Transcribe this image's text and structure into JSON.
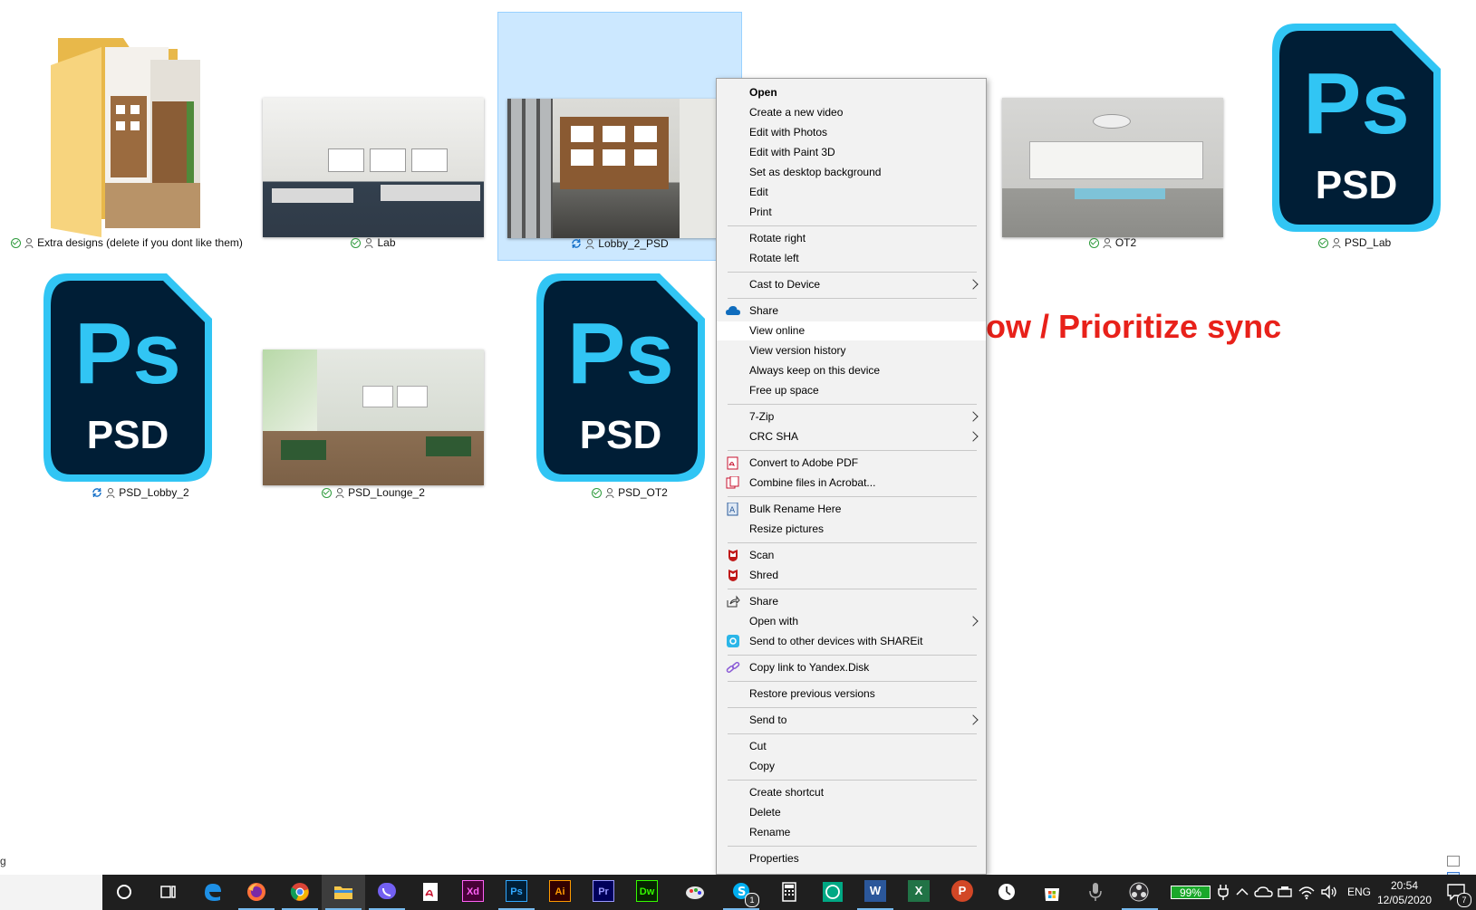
{
  "files": [
    {
      "name": "Extra designs (delete if you dont like them)",
      "status": "ok"
    },
    {
      "name": "Lab",
      "status": "ok"
    },
    {
      "name": "Lobby_2_PSD",
      "status": "sync"
    },
    {
      "name": "OT2",
      "status": "ok"
    },
    {
      "name": "PSD_Lab",
      "status": "ok"
    },
    {
      "name": "PSD_Lobby_2",
      "status": "sync"
    },
    {
      "name": "PSD_Lounge_2",
      "status": "ok"
    },
    {
      "name": "PSD_OT2",
      "status": "ok"
    }
  ],
  "ps_icon": {
    "main": "Ps",
    "sub": "PSD",
    "color": "#31c5f4",
    "bg": "#001e36"
  },
  "context_menu": {
    "items": [
      "Open",
      "Create a new video",
      "Edit with Photos",
      "Edit with Paint 3D",
      "Set as desktop background",
      "Edit",
      "Print",
      "Rotate right",
      "Rotate left",
      "Cast to Device",
      "Share",
      "View online",
      "View version history",
      "Always keep on this device",
      "Free up space",
      "7-Zip",
      "CRC SHA",
      "Convert to Adobe PDF",
      "Combine files in Acrobat...",
      "Bulk Rename Here",
      "Resize pictures",
      "Scan",
      "Shred",
      "Share",
      "Open with",
      "Send to other devices with SHAREit",
      "Copy link to Yandex.Disk",
      "Restore previous versions",
      "Send to",
      "Cut",
      "Copy",
      "Create shortcut",
      "Delete",
      "Rename",
      "Properties"
    ]
  },
  "annotation": "Sync now / Prioritize sync",
  "statusbar_text": "g",
  "taskbar": {
    "battery": "99%",
    "language": "ENG",
    "time": "20:54",
    "date": "12/05/2020",
    "notification_count": "7",
    "skype_badge": "1",
    "app_labels": {
      "xd": "Xd",
      "ps": "Ps",
      "ai": "Ai",
      "pr": "Pr",
      "dw": "Dw",
      "excel": "X",
      "word": "W",
      "ppt": "P"
    }
  }
}
